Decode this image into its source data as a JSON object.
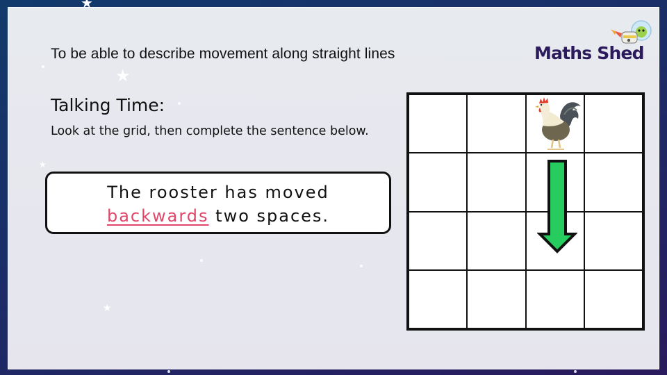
{
  "objective": "To be able to describe movement along straight lines",
  "logo": {
    "text": "Maths Shed",
    "brand_color": "#2b1a5c"
  },
  "talking_time": {
    "title": "Talking Time:",
    "instruction": "Look at the grid, then complete the sentence below."
  },
  "sentence": {
    "part1": "The rooster has moved",
    "answer": "backwards",
    "part2": "two spaces.",
    "answer_color": "#e0456a"
  },
  "grid": {
    "rows": 4,
    "columns": 4,
    "rooster_position": {
      "row": 1,
      "column": 3
    },
    "arrow": {
      "direction": "down",
      "spaces": 2,
      "color": "#27cc5f"
    }
  },
  "icons": {
    "rooster": "rooster-icon",
    "arrow": "arrow-down-icon",
    "mascot": "rocket-mascot-icon"
  }
}
